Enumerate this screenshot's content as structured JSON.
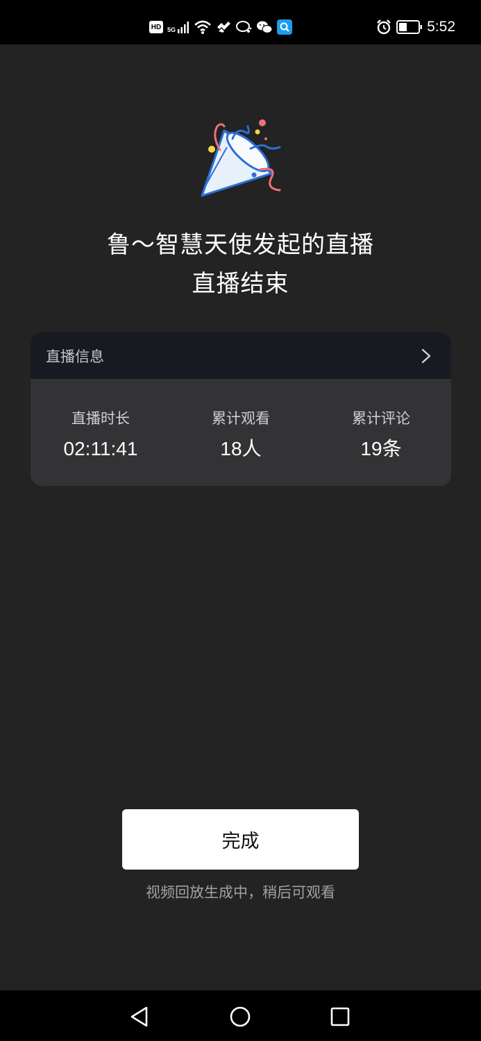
{
  "status_bar": {
    "hd": "HD",
    "network": "5G",
    "time": "5:52"
  },
  "live_end": {
    "title_line1": "鲁～智慧天使发起的直播",
    "title_line2": "直播结束",
    "info_card": {
      "title": "直播信息",
      "stats": [
        {
          "label": "直播时长",
          "value": "02:11:41"
        },
        {
          "label": "累计观看",
          "value": "18人"
        },
        {
          "label": "累计评论",
          "value": "19条"
        }
      ]
    },
    "done_label": "完成",
    "hint": "视频回放生成中，稍后可观看"
  },
  "icons": {
    "party": "party-popper-icon",
    "chevron": "chevron-right-icon",
    "nav_back": "back-triangle-icon",
    "nav_home": "home-circle-icon",
    "nav_recents": "recents-square-icon"
  },
  "colors": {
    "background": "#232323",
    "card_header": "#181a21",
    "card_body": "#333335",
    "button": "#ffffff"
  }
}
